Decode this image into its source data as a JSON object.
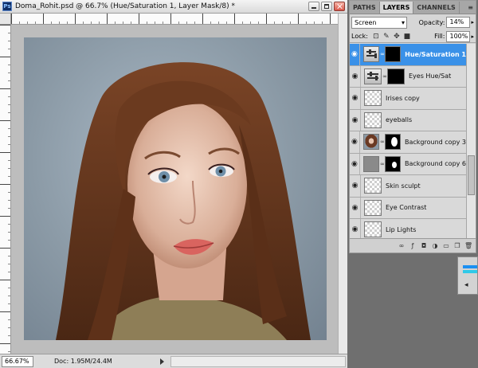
{
  "document": {
    "title": "Doma_Rohit.psd @ 66.7% (Hue/Saturation 1, Layer Mask/8) *",
    "zoom": "66.67%",
    "doc_info": "Doc: 1.95M/24.4M"
  },
  "panel": {
    "tabs": [
      "PATHS",
      "LAYERS",
      "CHANNELS"
    ],
    "active_tab": "LAYERS",
    "blend_mode": "Screen",
    "opacity_label": "Opacity:",
    "opacity_value": "14%",
    "lock_label": "Lock:",
    "fill_label": "Fill:",
    "fill_value": "100%"
  },
  "layers": [
    {
      "name": "Hue/Saturation 1",
      "selected": true
    },
    {
      "name": "Eyes Hue/Sat",
      "selected": false
    },
    {
      "name": "Irises copy",
      "selected": false
    },
    {
      "name": "eyeballs",
      "selected": false
    },
    {
      "name": "Background copy 3",
      "selected": false
    },
    {
      "name": "Background copy 6",
      "selected": false
    },
    {
      "name": "Skin sculpt",
      "selected": false
    },
    {
      "name": "Eye Contrast",
      "selected": false
    },
    {
      "name": "Lip Lights",
      "selected": false
    }
  ],
  "colors": {
    "selection": "#3a91e8",
    "workspace": "#6f6f6f"
  },
  "icons": {
    "ps_badge": "Ps"
  }
}
